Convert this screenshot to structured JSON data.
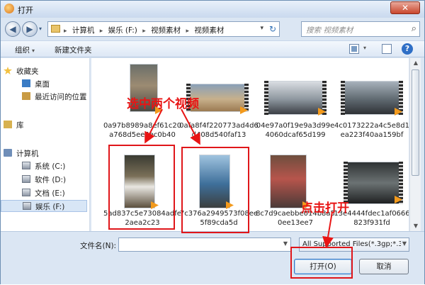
{
  "window": {
    "title": "打开",
    "close_glyph": "✕"
  },
  "nav": {
    "back_glyph": "◀",
    "forward_glyph": "▶",
    "dropdown_glyph": "▾"
  },
  "address": {
    "crumbs": [
      "计算机",
      "娱乐 (F:)",
      "视频素材",
      "视频素材"
    ],
    "separator": "▸",
    "refresh_glyph": "↻",
    "dropdown_glyph": "▾"
  },
  "search": {
    "placeholder": "搜索 视频素材",
    "icon": "search-icon"
  },
  "toolbar": {
    "organize": "组织",
    "new_folder": "新建文件夹",
    "help": "?",
    "dropdown_glyph": "▾"
  },
  "sidebar": {
    "items": [
      {
        "label": "收藏夹",
        "icon": "star-icon"
      },
      {
        "label": "桌面",
        "icon": "desktop-icon"
      },
      {
        "label": "最近访问的位置",
        "icon": "recent-places-icon"
      },
      {
        "label": "库",
        "icon": "library-icon"
      },
      {
        "label": "计算机",
        "icon": "computer-icon"
      },
      {
        "label": "系统 (C:)",
        "icon": "drive-icon"
      },
      {
        "label": "软件 (D:)",
        "icon": "drive-icon"
      },
      {
        "label": "文档 (E:)",
        "icon": "drive-icon"
      },
      {
        "label": "娱乐 (F:)",
        "icon": "drive-icon",
        "selected": true
      }
    ]
  },
  "files": [
    {
      "name": "0a97b8989a8ef61c20a768d5ee4ec0b40"
    },
    {
      "name": "0afa8f4f220773ad4d6d408d540faf13"
    },
    {
      "name": "04e97a0f19e9a3d99e4060dcaf65d199"
    },
    {
      "name": "4c0173222a4c5e8d1ea223f40aa159bf"
    },
    {
      "name": "5ad837c5e73084adfe2aea2c23"
    },
    {
      "name": "7c376a2949573f08ee5f89cda5d"
    },
    {
      "name": "8c7d9caebbe014b8a50ee13ee7"
    },
    {
      "name": "13e4444fdec1af0666823f931fd"
    }
  ],
  "bottom": {
    "filename_label": "文件名(N):",
    "filename_value": "",
    "filetype": "All Supported Files(*.3gp;*.3",
    "open_button": "打开(O)",
    "cancel_button": "取消"
  },
  "annotations": {
    "select_two": "选中两个视频",
    "click_open": "点击打开"
  },
  "colors": {
    "annotation_red": "#e81515",
    "play_orange": "#f39a1c",
    "accent_blue": "#3a76c0"
  }
}
